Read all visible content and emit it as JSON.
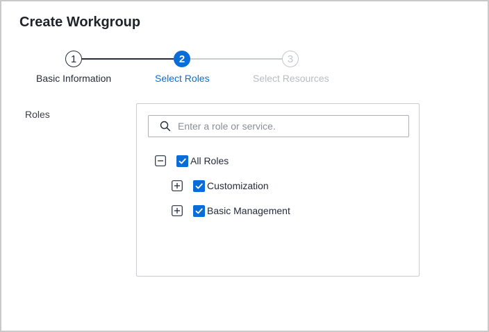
{
  "title": "Create Workgroup",
  "stepper": {
    "steps": [
      {
        "number": "1",
        "label": "Basic Information",
        "state": "completed"
      },
      {
        "number": "2",
        "label": "Select Roles",
        "state": "active"
      },
      {
        "number": "3",
        "label": "Select Resources",
        "state": "pending"
      }
    ]
  },
  "roles": {
    "label": "Roles",
    "search": {
      "placeholder": "Enter a role or service.",
      "value": ""
    },
    "tree": [
      {
        "label": "All Roles",
        "checked": true,
        "expanded": true,
        "icon": "collapse-icon"
      },
      {
        "label": "Customization",
        "checked": true,
        "expanded": false,
        "icon": "expand-icon"
      },
      {
        "label": "Basic Management",
        "checked": true,
        "expanded": false,
        "icon": "expand-icon"
      }
    ]
  },
  "colors": {
    "accent": "#0a6cd6",
    "text": "#252b3a",
    "disabled": "#b8bcc2",
    "border": "#c9ccd1"
  }
}
